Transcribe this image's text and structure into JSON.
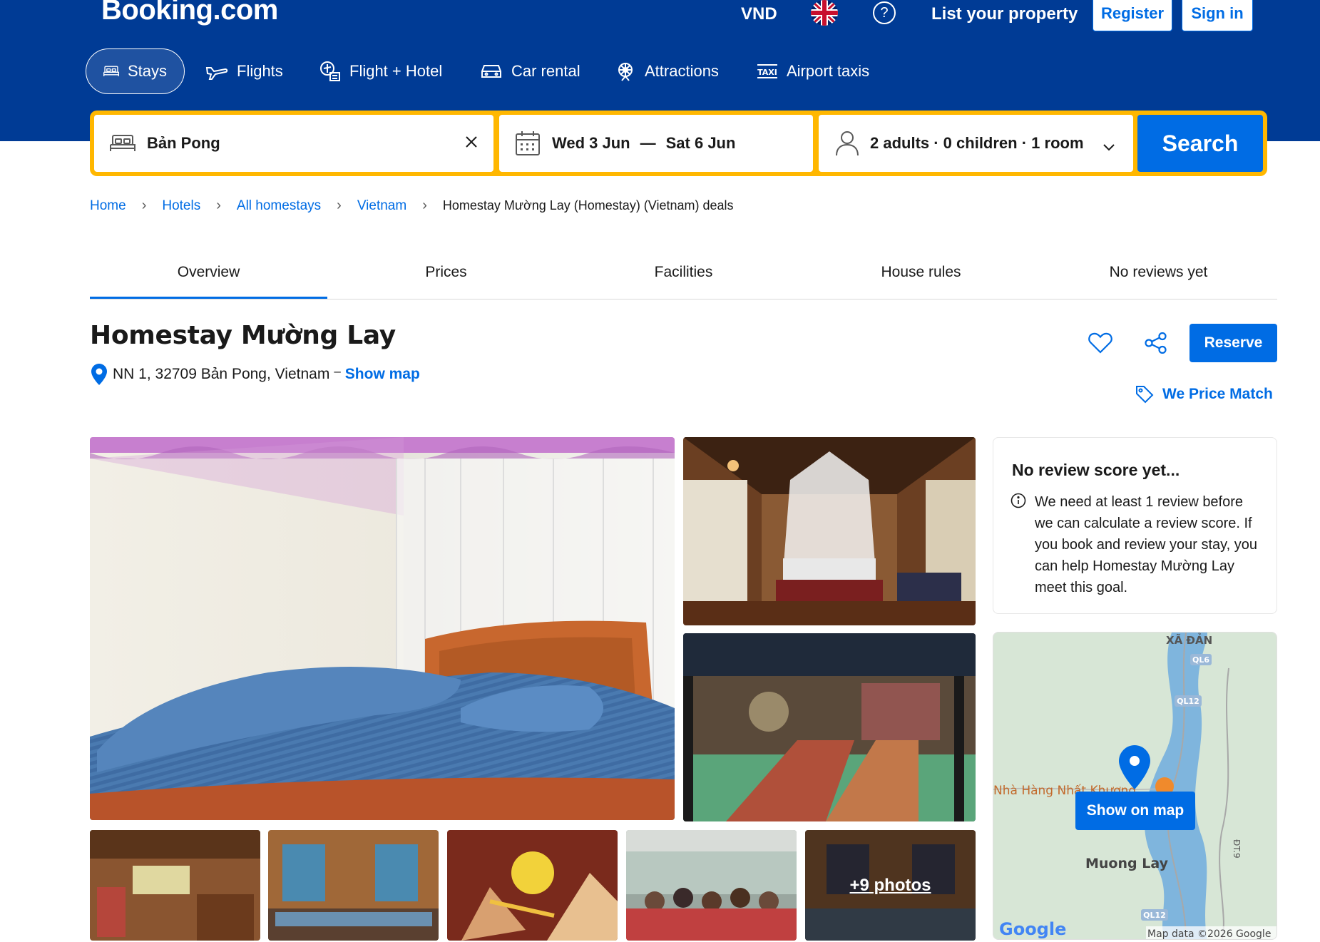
{
  "header": {
    "logo": "Booking.com",
    "currency": "VND",
    "list_property": "List your property",
    "register": "Register",
    "sign_in": "Sign in"
  },
  "nav": {
    "tabs": [
      {
        "label": "Stays",
        "icon": "bed-icon",
        "active": true
      },
      {
        "label": "Flights",
        "icon": "plane-icon"
      },
      {
        "label": "Flight + Hotel",
        "icon": "flight-hotel-icon"
      },
      {
        "label": "Car rental",
        "icon": "car-icon"
      },
      {
        "label": "Attractions",
        "icon": "attractions-icon"
      },
      {
        "label": "Airport taxis",
        "icon": "taxi-icon"
      }
    ]
  },
  "search": {
    "destination": "Bản Pong",
    "checkin": "Wed 3 Jun",
    "dash": "—",
    "checkout": "Sat 6 Jun",
    "guests": "2 adults · 0 children · 1 room",
    "button": "Search"
  },
  "breadcrumb": [
    "Home",
    "Hotels",
    "All homestays",
    "Vietnam",
    "Homestay Mường Lay (Homestay) (Vietnam) deals"
  ],
  "tabs": [
    "Overview",
    "Prices",
    "Facilities",
    "House rules",
    "No reviews yet"
  ],
  "property": {
    "name": "Homestay Mường Lay",
    "address": "NN 1, 32709 Bản Pong, Vietnam",
    "dash": "–",
    "show_map": "Show map",
    "reserve": "Reserve",
    "price_match": "We Price Match"
  },
  "photos": {
    "more": "+9 photos"
  },
  "review": {
    "title": "No review score yet...",
    "text": "We need at least 1 review before we can calculate a review score. If you book and review your stay, you can help Homestay Mường Lay meet this goal."
  },
  "map": {
    "button": "Show on map",
    "labels": {
      "xa_dan": "XÃ ĐẢN",
      "ql6": "QL6",
      "ql12_top": "QL12",
      "restaurant": "Nhà Hàng Nhất Khương",
      "muong_lay": "Muong Lay",
      "road": "ĐT.9",
      "ql12_bottom": "QL12",
      "google": "Google",
      "attribution": "Map data ©2026 Google"
    }
  },
  "colors": {
    "brand_blue": "#003b95",
    "action_blue": "#006ce4",
    "search_yellow": "#ffb700"
  }
}
